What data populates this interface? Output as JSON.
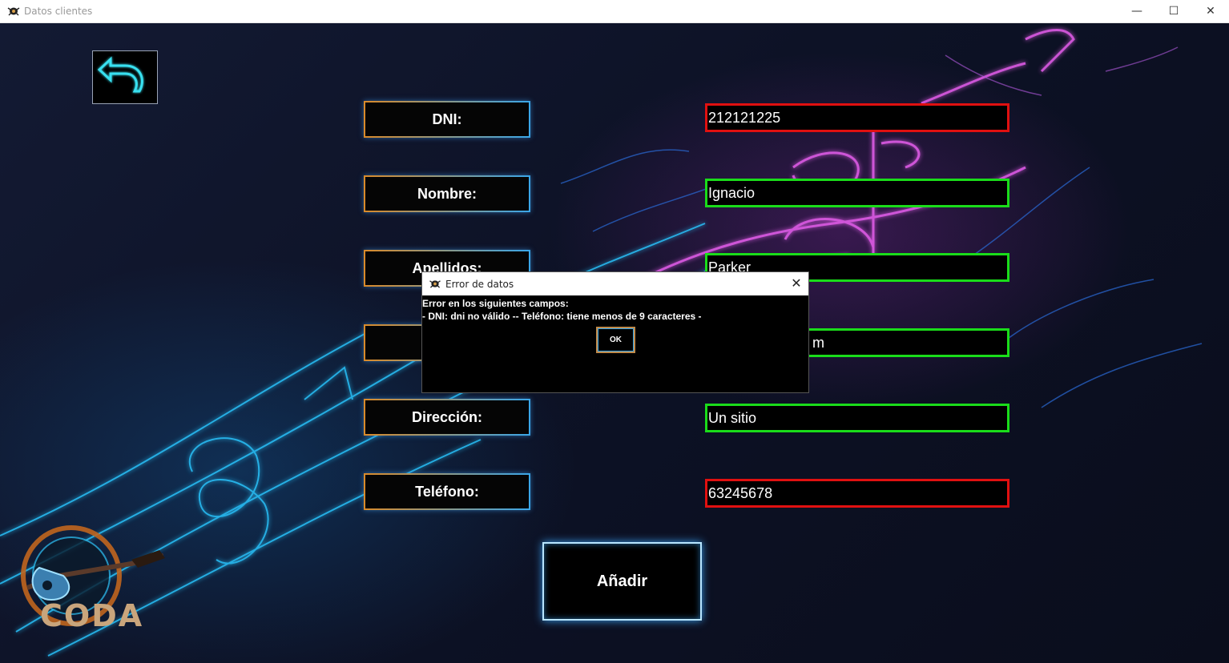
{
  "window": {
    "title": "Datos clientes",
    "minimize": "—",
    "maximize": "☐",
    "close": "✕"
  },
  "form": {
    "labels": {
      "dni": "DNI:",
      "nombre": "Nombre:",
      "apellidos": "Apellidos:",
      "correo": "",
      "direccion": "Dirección:",
      "telefono": "Teléfono:"
    },
    "values": {
      "dni": "212121225",
      "nombre": "Ignacio",
      "apellidos": "Parker",
      "correo": "m",
      "direccion": "Un sitio",
      "telefono": "63245678"
    },
    "status_colors": {
      "invalid": "#e01010",
      "valid": "#1adc1a"
    },
    "add_label": "Añadir"
  },
  "logo": {
    "text": "CODA"
  },
  "dialog": {
    "title": "Error de datos",
    "close": "✕",
    "line1": "Error en los siguientes campos:",
    "line2": "- DNI: dni no válido -- Teléfono: tiene menos de 9 caracteres -",
    "ok_label": "OK"
  }
}
